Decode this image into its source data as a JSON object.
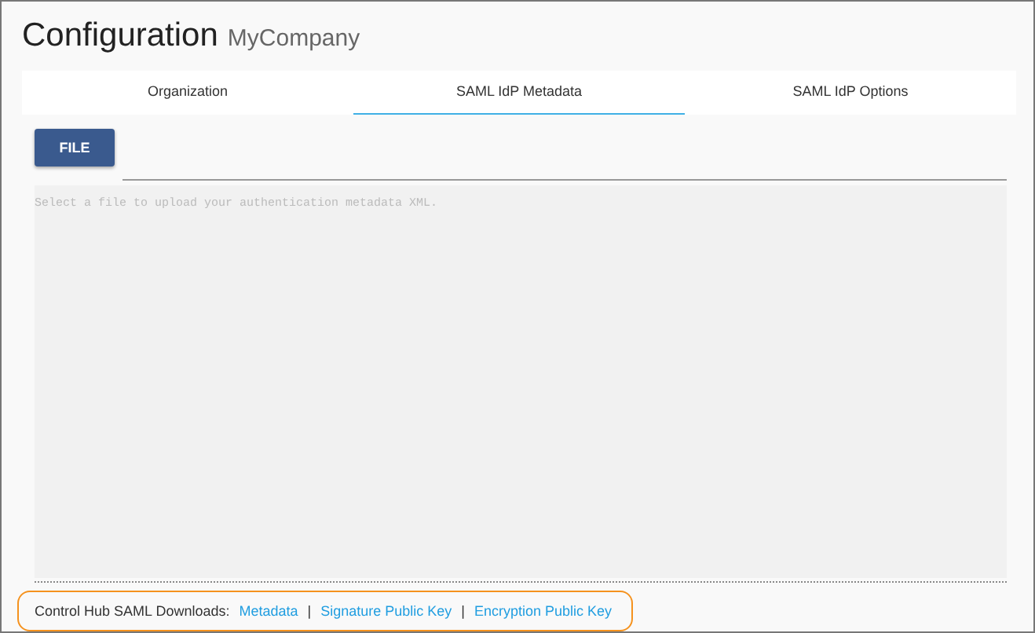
{
  "header": {
    "title": "Configuration",
    "subtitle": "MyCompany"
  },
  "tabs": [
    {
      "label": "Organization",
      "selected": false
    },
    {
      "label": "SAML IdP Metadata",
      "selected": true
    },
    {
      "label": "SAML IdP Options",
      "selected": false
    }
  ],
  "file_button": {
    "label": "FILE"
  },
  "metadata_field": {
    "placeholder": "Select a file to upload your authentication metadata XML."
  },
  "downloads": {
    "label": "Control Hub SAML Downloads:",
    "highlighted": true,
    "items": [
      {
        "kind": "link",
        "text": "Metadata"
      },
      {
        "kind": "separator",
        "text": "|"
      },
      {
        "kind": "link",
        "text": "Signature Public Key"
      },
      {
        "kind": "separator",
        "text": "|"
      },
      {
        "kind": "link",
        "text": "Encryption Public Key"
      }
    ]
  }
}
